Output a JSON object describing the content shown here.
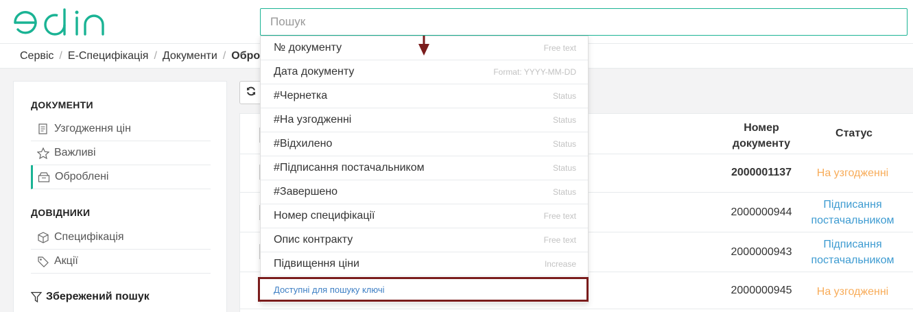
{
  "header": {
    "logo_text": "edin",
    "search_placeholder": "Пошук"
  },
  "breadcrumb": [
    "Сервіс",
    "Е-Специфікація",
    "Документи",
    "Обро"
  ],
  "sidebar": {
    "documents_title": "ДОКУМЕНТИ",
    "documents": [
      {
        "label": "Узгодження цін",
        "icon": "document-icon"
      },
      {
        "label": "Важливі",
        "icon": "star-icon"
      },
      {
        "label": "Оброблені",
        "icon": "archive-icon"
      }
    ],
    "references_title": "ДОВІДНИКИ",
    "references": [
      {
        "label": "Специфікація",
        "icon": "cube-icon"
      },
      {
        "label": "Акції",
        "icon": "tag-icon"
      }
    ],
    "saved_search": "Збережений пошук"
  },
  "table": {
    "columns": [
      "Номер документу",
      "Статус"
    ],
    "rows": [
      {
        "number": "2000001137",
        "status": "На узгодженні",
        "bold": true
      },
      {
        "number": "2000000944",
        "status": "Підписання постачальником",
        "bold": false
      },
      {
        "number": "2000000943",
        "status": "Підписання постачальником",
        "bold": false
      },
      {
        "number": "2000000945",
        "status": "На узгодженні",
        "bold": false
      }
    ]
  },
  "dropdown": {
    "items": [
      {
        "label": "№ документу",
        "hint": "Free text"
      },
      {
        "label": "Дата документу",
        "hint": "Format: YYYY-MM-DD"
      },
      {
        "label": "#Чернетка",
        "hint": "Status"
      },
      {
        "label": "#На узгодженні",
        "hint": "Status"
      },
      {
        "label": "#Відхилено",
        "hint": "Status"
      },
      {
        "label": "#Підписання постачальником",
        "hint": "Status"
      },
      {
        "label": "#Завершено",
        "hint": "Status"
      },
      {
        "label": "Номер специфікації",
        "hint": "Free text"
      },
      {
        "label": "Опис контракту",
        "hint": "Free text"
      },
      {
        "label": "Підвищення ціни",
        "hint": "Increase"
      }
    ],
    "available_keys": "Доступні для пошуку ключі"
  },
  "colors": {
    "accent": "#1ab394",
    "status_pending": "#f8ac59",
    "status_signing": "#3d9bd1",
    "highlight_frame": "#7a1c1c"
  }
}
